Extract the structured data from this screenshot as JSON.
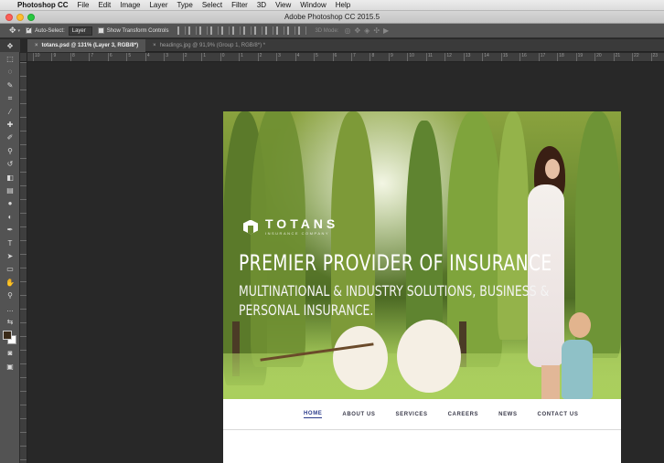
{
  "menubar": {
    "apple": "",
    "items": [
      "Photoshop CC",
      "File",
      "Edit",
      "Image",
      "Layer",
      "Type",
      "Select",
      "Filter",
      "3D",
      "View",
      "Window",
      "Help"
    ]
  },
  "window": {
    "title": "Adobe Photoshop CC 2015.5"
  },
  "options_bar": {
    "auto_select_label": "Auto-Select:",
    "auto_select_checked": true,
    "auto_select_value": "Layer",
    "transform_controls_label": "Show Transform Controls",
    "mode_3d_label": "3D Mode:"
  },
  "tabs": [
    {
      "label": "totans.psd @ 131% (Layer 3, RGB/8*)",
      "active": true
    },
    {
      "label": "headings.jpg @ 91,9% (Group 1, RGB/8*) *",
      "active": false
    }
  ],
  "ruler": {
    "top_ticks": [
      "10",
      "9",
      "8",
      "7",
      "6",
      "5",
      "4",
      "3",
      "2",
      "1",
      "0",
      "1",
      "2",
      "3",
      "4",
      "5",
      "6",
      "7",
      "8",
      "9",
      "10",
      "11",
      "12",
      "13",
      "14",
      "15",
      "16",
      "17",
      "18",
      "19",
      "20",
      "21",
      "22",
      "23"
    ]
  },
  "colors": {
    "foreground": "#3a2a18",
    "background": "#ffffff",
    "accent_nav": "#2a3a8a"
  },
  "document": {
    "logo": {
      "name": "TOTANS",
      "subtitle": "INSURANCE COMPANY"
    },
    "headline": "PREMIER PROVIDER OF INSURANCE",
    "subheadline": "MULTINATIONAL & INDUSTRY SOLUTIONS, BUSINESS & PERSONAL INSURANCE.",
    "nav": [
      {
        "label": "HOME",
        "active": true
      },
      {
        "label": "ABOUT US",
        "active": false
      },
      {
        "label": "SERVICES",
        "active": false
      },
      {
        "label": "CAREERS",
        "active": false
      },
      {
        "label": "NEWS",
        "active": false
      },
      {
        "label": "CONTACT US",
        "active": false
      }
    ]
  },
  "toolbar": {
    "tools": [
      {
        "name": "move-tool",
        "glyph": "✥"
      },
      {
        "name": "marquee-tool",
        "glyph": "⬚"
      },
      {
        "name": "lasso-tool",
        "glyph": "◌"
      },
      {
        "name": "quick-select-tool",
        "glyph": "✎"
      },
      {
        "name": "crop-tool",
        "glyph": "⌗"
      },
      {
        "name": "eyedropper-tool",
        "glyph": "⁄"
      },
      {
        "name": "healing-tool",
        "glyph": "✚"
      },
      {
        "name": "brush-tool",
        "glyph": "✐"
      },
      {
        "name": "clone-stamp-tool",
        "glyph": "⚲"
      },
      {
        "name": "history-brush-tool",
        "glyph": "↺"
      },
      {
        "name": "eraser-tool",
        "glyph": "◧"
      },
      {
        "name": "gradient-tool",
        "glyph": "▤"
      },
      {
        "name": "blur-tool",
        "glyph": "●"
      },
      {
        "name": "dodge-tool",
        "glyph": "◐"
      },
      {
        "name": "pen-tool",
        "glyph": "✒"
      },
      {
        "name": "type-tool",
        "glyph": "T"
      },
      {
        "name": "path-select-tool",
        "glyph": "➤"
      },
      {
        "name": "shape-tool",
        "glyph": "▭"
      },
      {
        "name": "hand-tool",
        "glyph": "✋"
      },
      {
        "name": "zoom-tool",
        "glyph": "⚲"
      },
      {
        "name": "more-tools",
        "glyph": "…"
      },
      {
        "name": "swap-colors",
        "glyph": "⇆"
      }
    ],
    "bottom_tools": [
      {
        "name": "quick-mask-tool",
        "glyph": "◙"
      },
      {
        "name": "screen-mode-tool",
        "glyph": "▣"
      }
    ]
  }
}
